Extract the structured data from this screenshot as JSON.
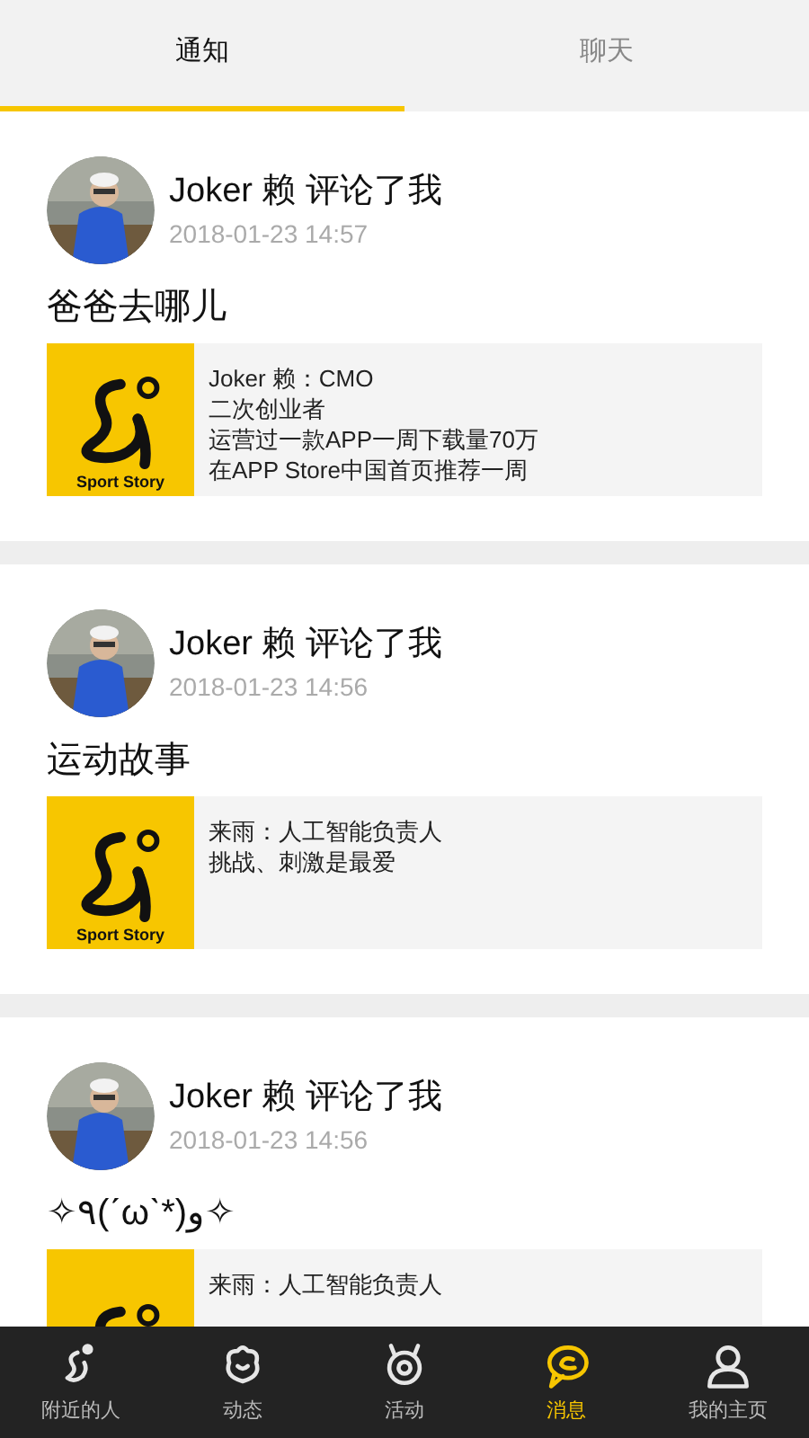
{
  "tabs": [
    {
      "label": "通知",
      "selected": true
    },
    {
      "label": "聊天",
      "selected": false
    }
  ],
  "notifications": [
    {
      "author": "Joker 赖 评论了我",
      "time": "2018-01-23 14:57",
      "comment": "爸爸去哪儿",
      "logo_text": "Sport Story",
      "preview": [
        "Joker 赖：CMO",
        "二次创业者",
        "运营过一款APP一周下载量70万",
        "在APP Store中国首页推荐一周"
      ]
    },
    {
      "author": "Joker 赖 评论了我",
      "time": "2018-01-23 14:56",
      "comment": "运动故事",
      "logo_text": "Sport Story",
      "preview": [
        "来雨：人工智能负责人",
        "挑战、刺激是最爱"
      ]
    },
    {
      "author": "Joker 赖 评论了我",
      "time": "2018-01-23 14:56",
      "comment": "✧٩(ˊωˋ*)و✧",
      "preview": [
        "来雨：人工智能负责人"
      ]
    }
  ],
  "bottom_nav": [
    {
      "label": "附近的人",
      "kind": "runner",
      "selected": false
    },
    {
      "label": "动态",
      "kind": "face",
      "selected": false
    },
    {
      "label": "活动",
      "kind": "ring",
      "selected": false
    },
    {
      "label": "消息",
      "kind": "chat",
      "selected": true
    },
    {
      "label": "我的主页",
      "kind": "person",
      "selected": false
    }
  ]
}
